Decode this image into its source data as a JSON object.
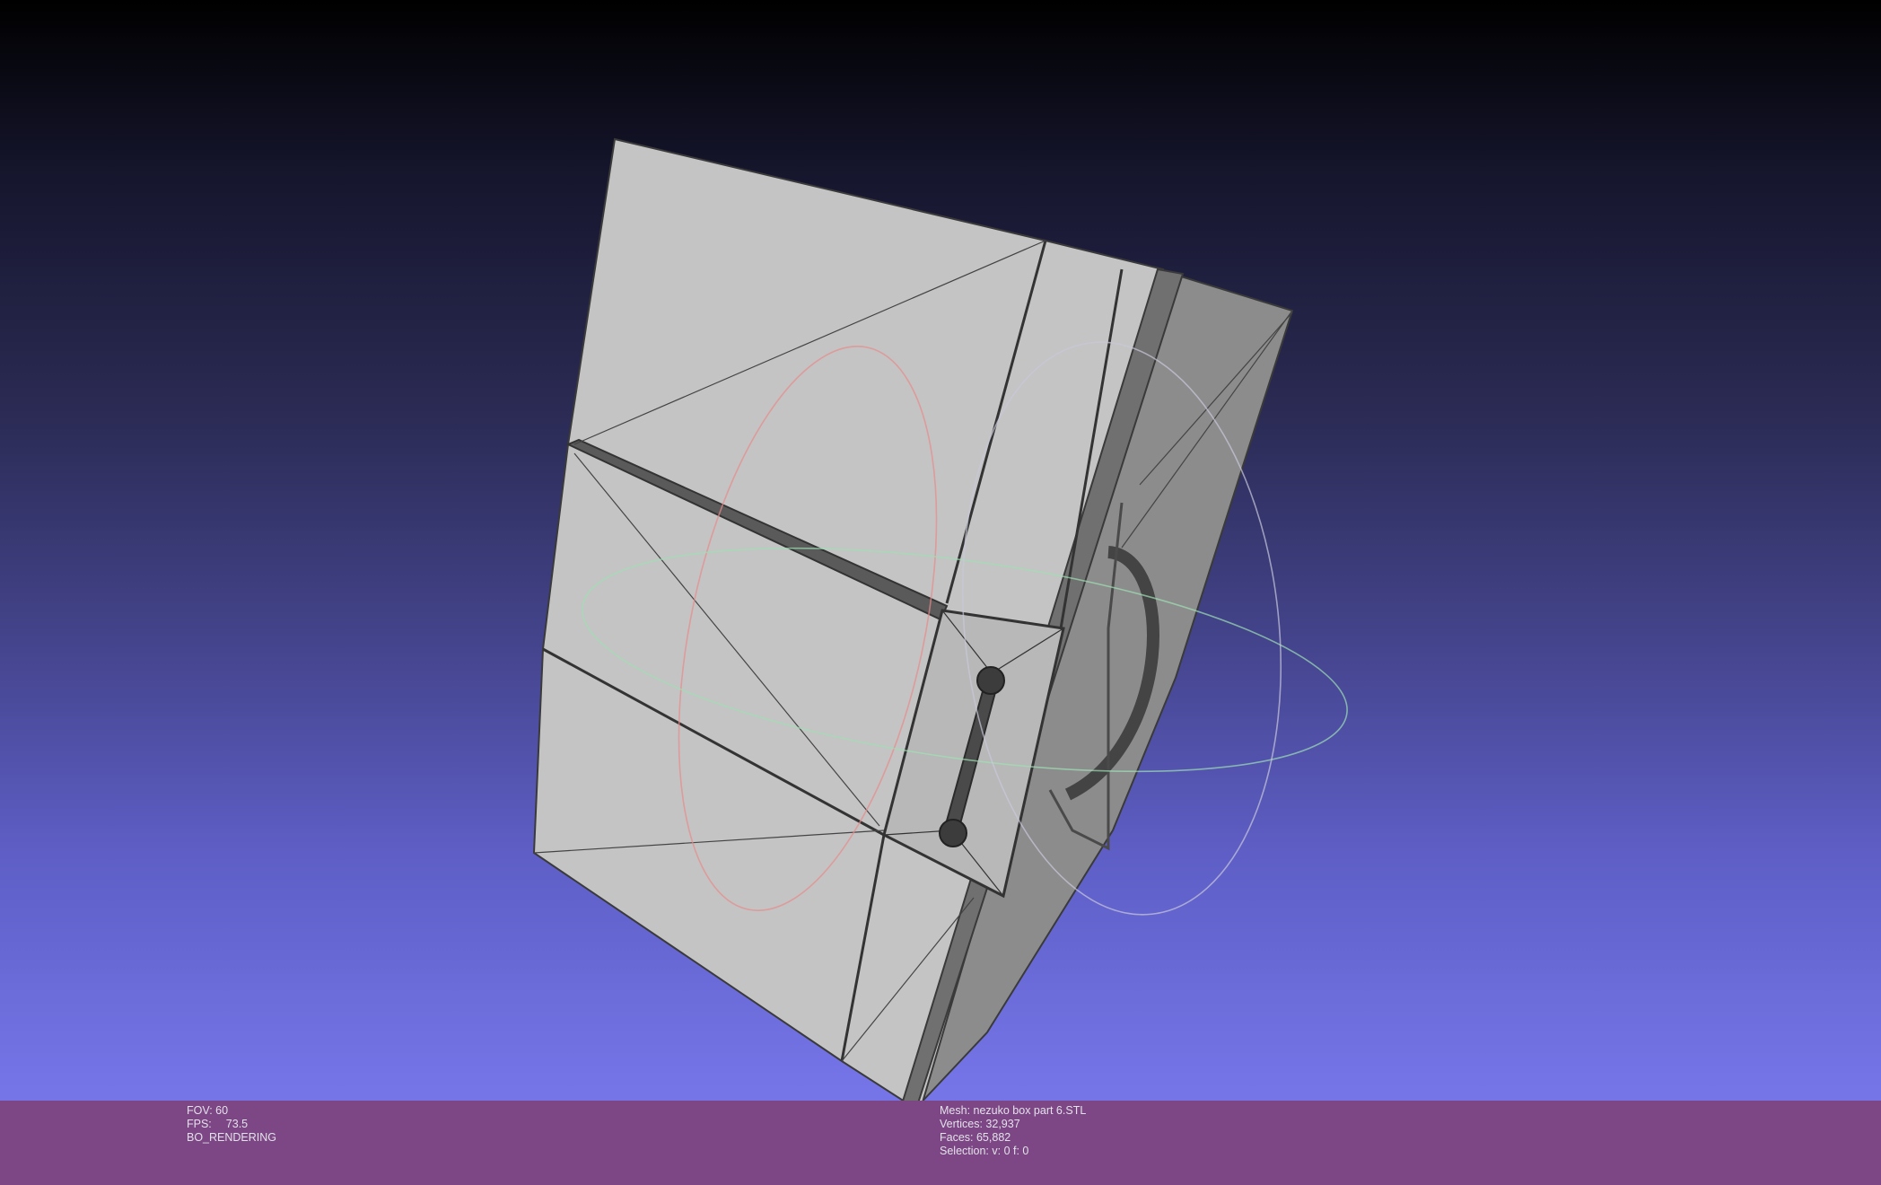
{
  "window": {
    "app": "MeshLab viewer"
  },
  "viewport": {
    "background_top": "#000000",
    "background_bottom": "#7575e8",
    "mesh_color": "#c4c4c4",
    "shade_color": "#8a8a8a",
    "edge_color": "#3a3a3a",
    "trackball_colors": {
      "x": "#e88a8a",
      "y": "#9ee0b4",
      "z": "#c9c9dc"
    }
  },
  "status": {
    "background": "#7d4684",
    "fov_label": "FOV: 60",
    "fps_label": "FPS:",
    "fps_value": "73.5",
    "render_mode": "BO_RENDERING",
    "mesh_label": "Mesh: nezuko box part 6.STL",
    "vertices_label": "Vertices: 32,937",
    "faces_label": "Faces: 65,882",
    "selection_label": "Selection: v: 0 f: 0"
  }
}
